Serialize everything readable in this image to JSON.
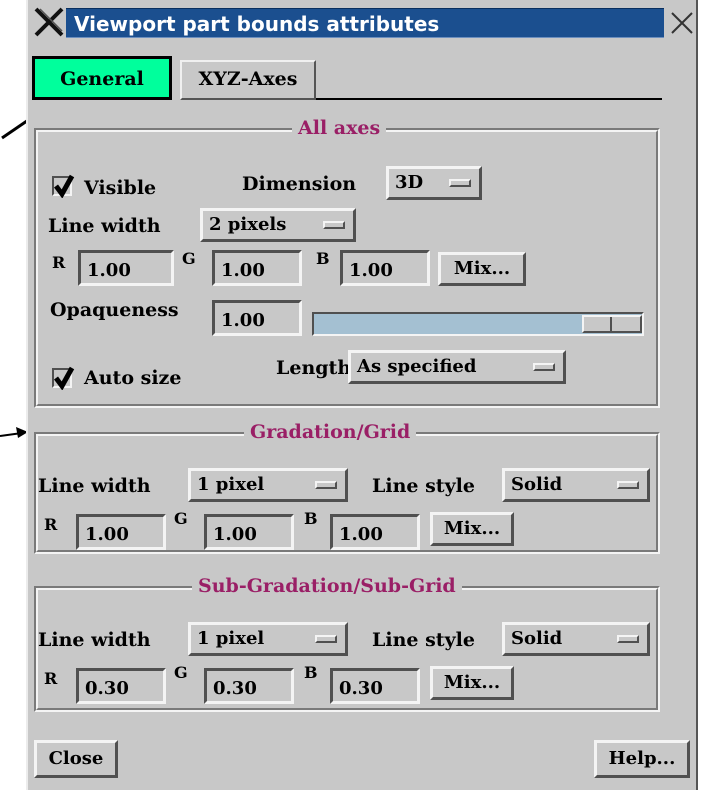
{
  "window": {
    "title": "Viewport part bounds attributes"
  },
  "tabs": [
    {
      "label": "General",
      "active": true
    },
    {
      "label": "XYZ-Axes",
      "active": false
    }
  ],
  "all_axes": {
    "title": "All axes",
    "visible": {
      "label": "Visible",
      "checked": true
    },
    "dimension": {
      "label": "Dimension",
      "value": "3D"
    },
    "line_width": {
      "label": "Line width",
      "value": "2 pixels"
    },
    "r": {
      "label": "R",
      "value": "1.00"
    },
    "g": {
      "label": "G",
      "value": "1.00"
    },
    "b": {
      "label": "B",
      "value": "1.00"
    },
    "mix_label": "Mix...",
    "opaqueness": {
      "label": "Opaqueness",
      "value": "1.00",
      "slider_fraction": 1.0
    },
    "auto_size": {
      "label": "Auto size",
      "checked": true
    },
    "length": {
      "label": "Length",
      "value": "As specified"
    }
  },
  "gradation": {
    "title": "Gradation/Grid",
    "line_width": {
      "label": "Line width",
      "value": "1 pixel"
    },
    "line_style": {
      "label": "Line style",
      "value": "Solid"
    },
    "r": {
      "label": "R",
      "value": "1.00"
    },
    "g": {
      "label": "G",
      "value": "1.00"
    },
    "b": {
      "label": "B",
      "value": "1.00"
    },
    "mix_label": "Mix..."
  },
  "subgradation": {
    "title": "Sub-Gradation/Sub-Grid",
    "line_width": {
      "label": "Line width",
      "value": "1 pixel"
    },
    "line_style": {
      "label": "Line style",
      "value": "Solid"
    },
    "r": {
      "label": "R",
      "value": "0.30"
    },
    "g": {
      "label": "G",
      "value": "0.30"
    },
    "b": {
      "label": "B",
      "value": "0.30"
    },
    "mix_label": "Mix..."
  },
  "footer": {
    "close_label": "Close",
    "help_label": "Help..."
  },
  "colors": {
    "title_bar": "#1b4f8f",
    "active_tab": "#00ff9c",
    "section_title": "#9a1f66",
    "slider_track": "#a4c0d2"
  }
}
